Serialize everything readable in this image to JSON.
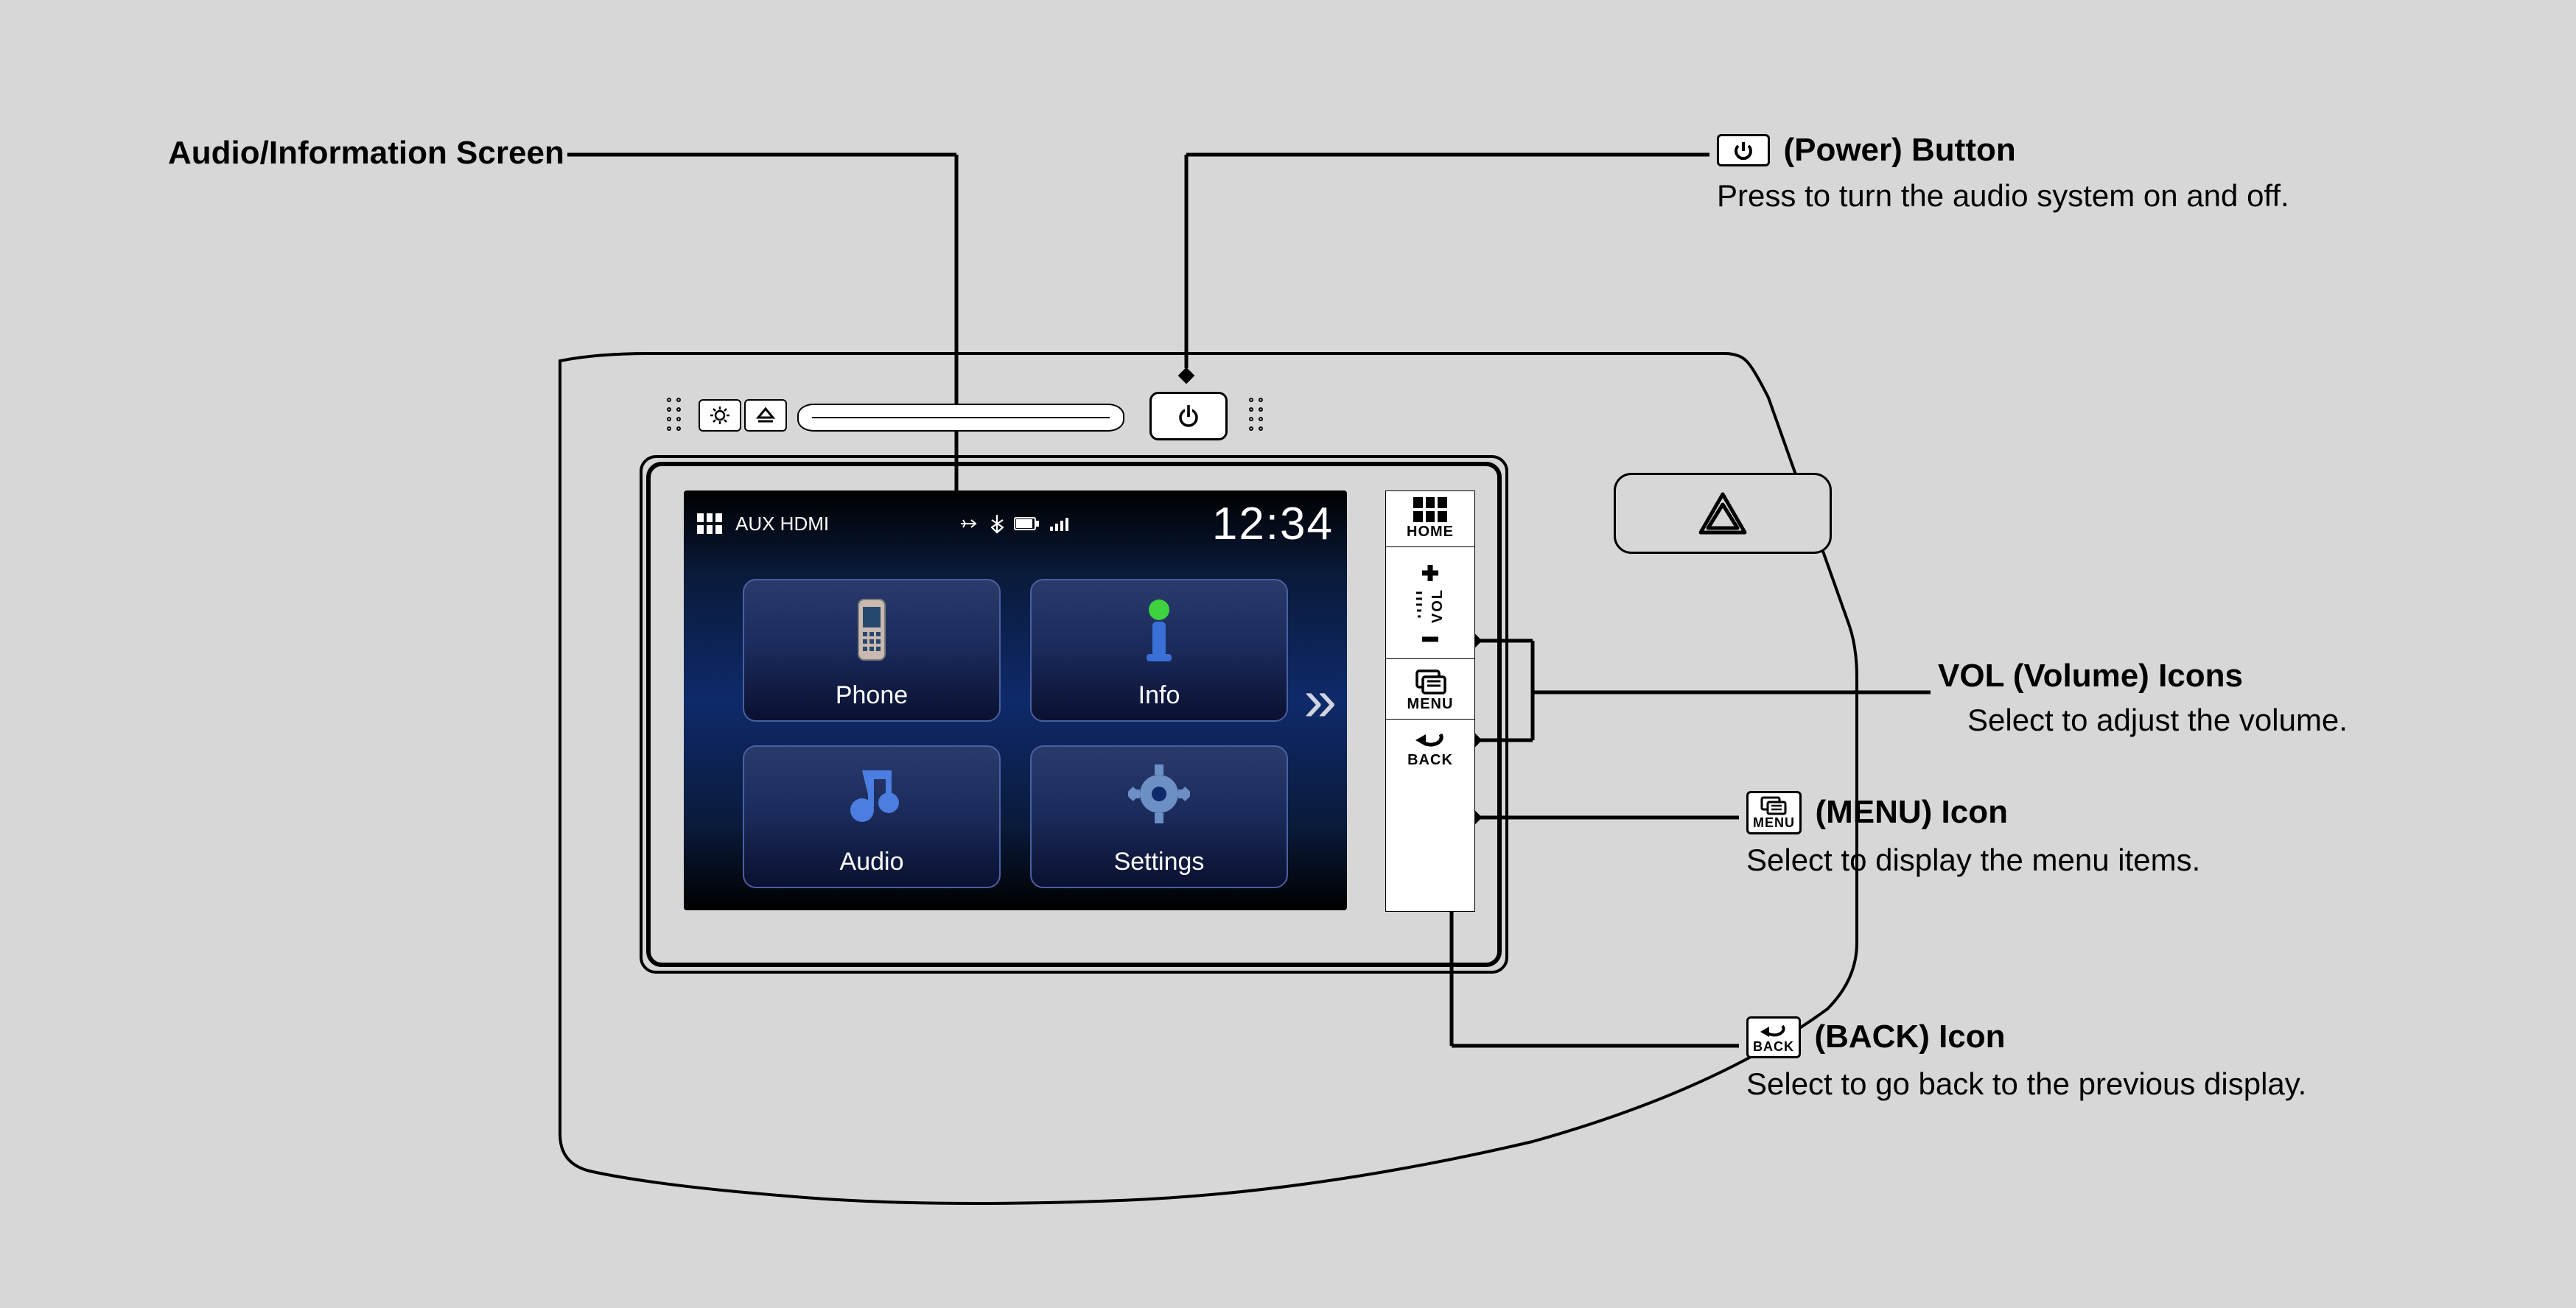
{
  "callouts": {
    "audio_screen": {
      "title": "Audio/Information Screen"
    },
    "power": {
      "title": "(Power) Button",
      "desc": "Press to turn the audio system on and off."
    },
    "vol": {
      "title": "VOL (Volume) Icons",
      "desc": "Select to adjust the volume."
    },
    "menu": {
      "title": "(MENU) Icon",
      "desc": "Select to display the menu items.",
      "icon_cap": "MENU"
    },
    "back": {
      "title": "(BACK) Icon",
      "desc": "Select to go back to the previous display.",
      "icon_cap": "BACK"
    }
  },
  "screen": {
    "source": "AUX HDMI",
    "time": "12:34",
    "tiles": {
      "phone": "Phone",
      "info": "Info",
      "audio": "Audio",
      "settings": "Settings"
    }
  },
  "softkeys": {
    "home": "HOME",
    "vol": "VOL",
    "menu": "MENU",
    "back": "BACK"
  }
}
